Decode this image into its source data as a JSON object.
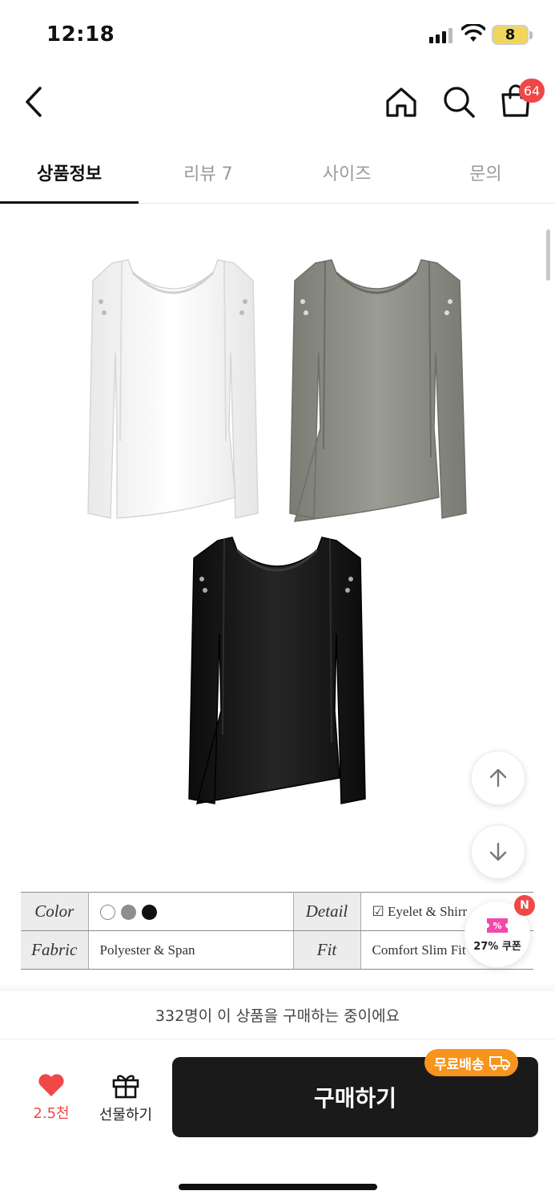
{
  "status_bar": {
    "time": "12:18",
    "battery": "8"
  },
  "nav": {
    "cart_count": "64"
  },
  "tabs": [
    {
      "label": "상품정보",
      "active": true
    },
    {
      "label": "리뷰 7",
      "active": false
    },
    {
      "label": "사이즈",
      "active": false
    },
    {
      "label": "문의",
      "active": false
    }
  ],
  "product_images": [
    {
      "color_name": "white",
      "color": "#f6f6f6"
    },
    {
      "color_name": "gray",
      "color": "#8b8d84"
    },
    {
      "color_name": "black",
      "color": "#141414"
    }
  ],
  "spec": {
    "color_key": "Color",
    "color_swatches": [
      "#ffffff",
      "#8e8e8e",
      "#111111"
    ],
    "detail_key": "Detail",
    "detail_value": "Eyelet & Shirr",
    "fabric_key": "Fabric",
    "fabric_value": "Polyester & Span",
    "fit_key": "Fit",
    "fit_value": "Comfort Slim Fit"
  },
  "floating": {
    "coupon_label": "27% 쿠폰",
    "coupon_badge": "N"
  },
  "buying_text": "332명이 이 상품을 구매하는 중이에요",
  "bottom": {
    "like_count": "2.5천",
    "gift_label": "선물하기",
    "buy_label": "구매하기",
    "free_shipping_label": "무료배송"
  },
  "colors": {
    "accent_red": "#f04747",
    "buy_button": "#1a1a1a",
    "free_shipping": "#f7941d"
  }
}
